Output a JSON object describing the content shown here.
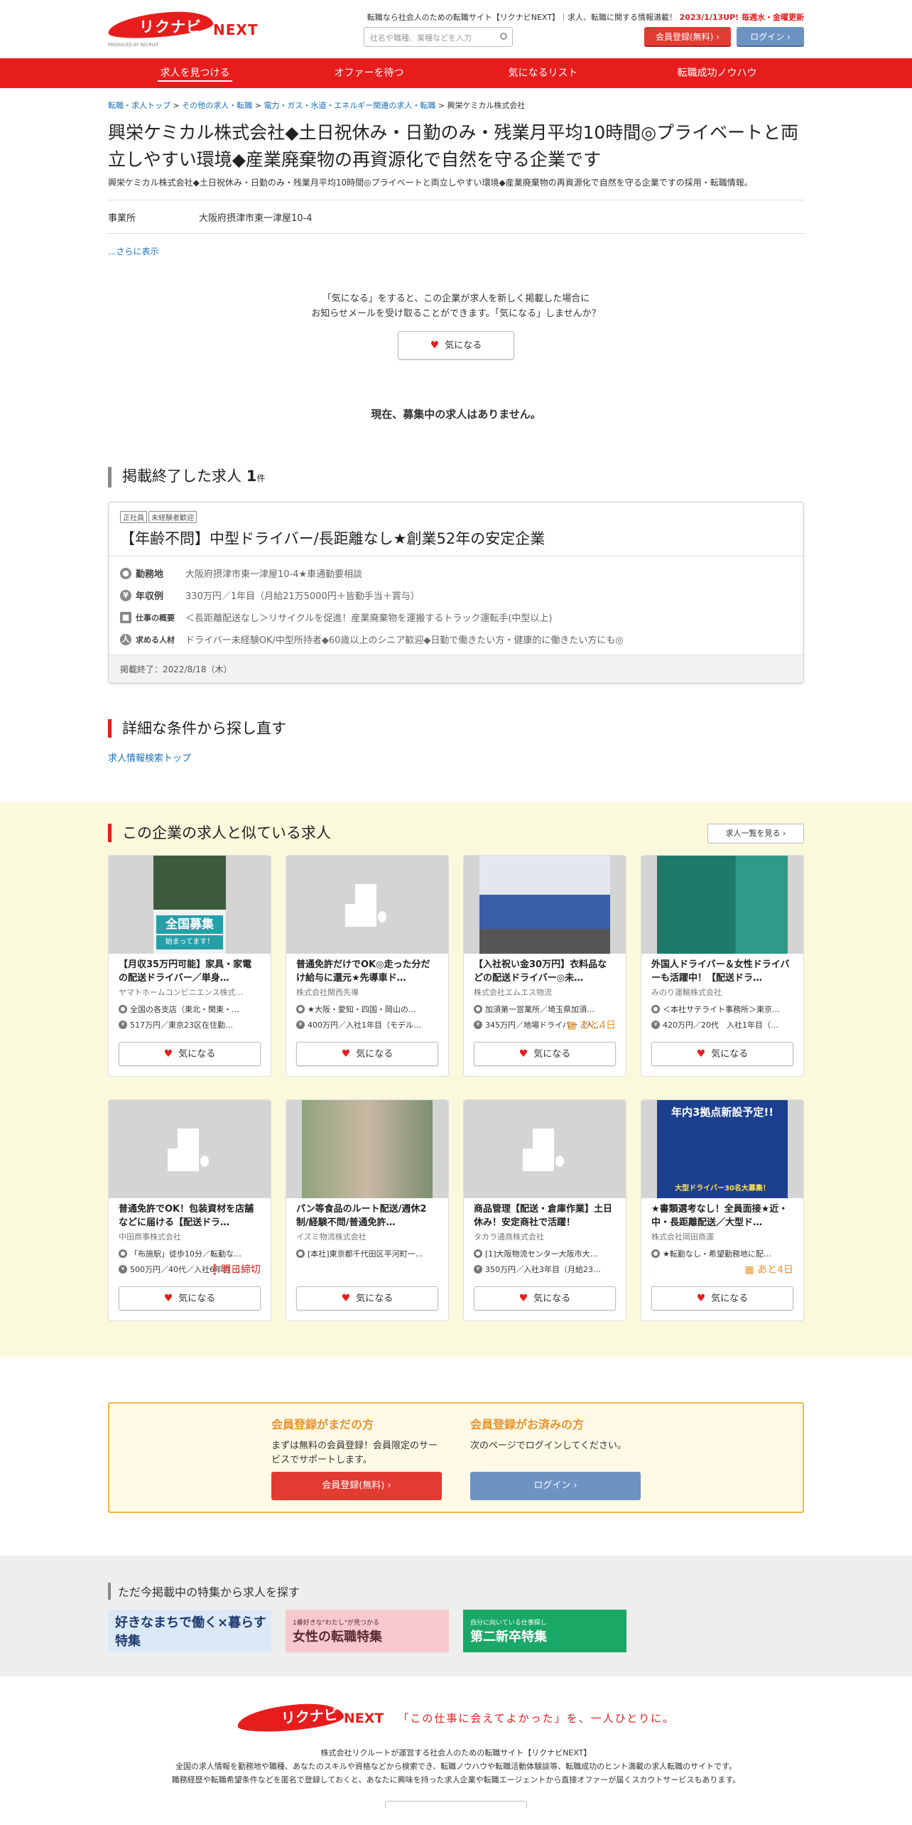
{
  "header": {
    "logo_text": "リクナビ",
    "logo_next": "NEXT",
    "logo_by": "PRODUCED BY RECRUIT",
    "tagline": "転職なら社会人のための転職サイト【リクナビNEXT】｜求人、転職に関する情報満載！",
    "update_note": "2023/1/13UP! 毎週水・金曜更新",
    "search_placeholder": "社名や職種、業種などを入力",
    "register_label": "会員登録(無料)",
    "login_label": "ログイン"
  },
  "nav": {
    "items": [
      "求人を見つける",
      "オファーを待つ",
      "気になるリスト",
      "転職成功ノウハウ"
    ]
  },
  "breadcrumb": {
    "items": [
      "転職・求人トップ",
      "その他の求人・転職",
      "電力・ガス・水道・エネルギー関連の求人・転職"
    ],
    "current": "興栄ケミカル株式会社",
    "sep": ">"
  },
  "company": {
    "title": "興栄ケミカル株式会社◆土日祝休み・日勤のみ・残業月平均10時間◎プライベートと両立しやすい環境◆産業廃棄物の再資源化で自然を守る企業です",
    "description": "興栄ケミカル株式会社◆土日祝休み・日勤のみ・残業月平均10時間◎プライベートと両立しやすい環境◆産業廃棄物の再資源化で自然を守る企業ですの採用・転職情報。",
    "office_label": "事業所",
    "office_value": "大阪府摂津市東一津屋10-4",
    "more_link": "...さらに表示"
  },
  "favorite": {
    "message_line1": "「気になる」をすると、この企業が求人を新しく掲載した場合に",
    "message_line2": "お知らせメールを受け取ることができます。「気になる」しませんか？",
    "button_label": "気になる"
  },
  "no_jobs_message": "現在、募集中の求人はありません。",
  "ended_section": {
    "heading": "掲載終了した求人",
    "count": "1",
    "count_unit": "件",
    "job": {
      "tags": [
        "正社員",
        "未経験者歓迎"
      ],
      "title": "【年齢不問】中型ドライバー/長距離なし★創業52年の安定企業",
      "rows": [
        {
          "label": "勤務地",
          "icon": "location-icon",
          "value": "大阪府摂津市東一津屋10-4★車通勤要相談"
        },
        {
          "label": "年収例",
          "icon": "yen-icon",
          "value": "330万円／1年目（月給21万5000円＋皆勤手当＋賞与）"
        },
        {
          "label": "仕事の概要",
          "icon": "briefcase-icon",
          "value": "＜長距離配送なし＞リサイクルを促進！産業廃棄物を運搬するトラック運転手(中型以上)"
        },
        {
          "label": "求める人材",
          "icon": "person-icon",
          "value": "ドライバー未経験OK/中型所持者◆60歳以上のシニア歓迎◆日勤で働きたい方・健康的に働きたい方にも◎"
        }
      ],
      "ended_date": "掲載終了：2022/8/18（木）"
    }
  },
  "search_again": {
    "heading": "詳細な条件から探し直す",
    "link": "求人情報検索トップ"
  },
  "similar": {
    "heading": "この企業の求人と似ている求人",
    "list_button": "求人一覧を見る",
    "fav_label": "気になる",
    "cards": [
      {
        "image": "photo-drivers",
        "img_text": "全国募集",
        "img_sub": "始まってます！",
        "title": "【月収35万円可能】家具・家電の配送ドライバー／単身…",
        "company": "ヤマトホームコンビニエンス株式…",
        "location": "全国の各支店（東北・関東・…",
        "salary": "517万円／東京23区在住勤…",
        "badge": ""
      },
      {
        "image": "building-placeholder",
        "img_text": "",
        "img_sub": "",
        "title": "普通免許だけでOK◎走った分だけ給与に還元★先導車ド…",
        "company": "株式会社関西先導",
        "location": "★大阪・愛知・四国・岡山の…",
        "salary": "400万円／入社1年目（モデル…",
        "badge": ""
      },
      {
        "image": "photo-trucks",
        "img_text": "",
        "img_sub": "",
        "title": "【入社祝い金30万円】衣料品などの配送ドライバー◎未…",
        "company": "株式会社エムエス物流",
        "location": "加須第一営業所／埼玉県加須…",
        "salary": "345万円／地場ドライバー（入…",
        "badge": "あと4日"
      },
      {
        "image": "photo-woman-truck",
        "img_text": "",
        "img_sub": "",
        "title": "外国人ドライバー＆女性ドライバーも活躍中！【配送ドラ…",
        "company": "みのり運輸株式会社",
        "location": "＜本社サテライト事務所＞東京…",
        "salary": "420万円／20代　入社1年目（…",
        "badge": ""
      },
      {
        "image": "building-placeholder",
        "img_text": "",
        "img_sub": "",
        "title": "普通免許でOK！包装資材を店舗などに届ける【配送ドラ…",
        "company": "中田商事株式会社",
        "location": "「布施駅」徒歩10分／転勤な…",
        "salary": "500万円／40代／入社6年目（…",
        "badge": "明日締切",
        "badge_red": true
      },
      {
        "image": "photo-two-women",
        "img_text": "",
        "img_sub": "",
        "title": "パン等食品のルート配送/週休2制/経験不問/普通免許…",
        "company": "イズミ物流株式会社",
        "location": "[本社]東京都千代田区平河町一…",
        "salary": "",
        "badge": ""
      },
      {
        "image": "building-placeholder",
        "img_text": "",
        "img_sub": "",
        "title": "商品管理【配送・倉庫作業】土日休み！安定商社で活躍！",
        "company": "タカラ通商株式会社",
        "location": "[1]大阪物流センター大阪市大…",
        "salary": "350万円／入社3年目（月給23…",
        "badge": ""
      },
      {
        "image": "photo-banner-blue",
        "img_text": "年内3拠点新設予定!!",
        "img_sub": "大型ドライバー30名大募集！",
        "title": "★書類選考なし！全員面接★近・中・長距離配送／大型ド…",
        "company": "株式会社岡田商運",
        "location": "★転勤なし・希望勤務地に配…",
        "salary": "",
        "badge": "あと4日"
      }
    ]
  },
  "register_box": {
    "left_heading": "会員登録がまだの方",
    "left_text": "まずは無料の会員登録！会員限定のサービスでサポートします。",
    "left_button": "会員登録(無料)",
    "right_heading": "会員登録がお済みの方",
    "right_text": "次のページでログインしてください。",
    "right_button": "ログイン"
  },
  "feature": {
    "heading": "ただ今掲載中の特集から求人を探す",
    "banners": [
      {
        "text": "好きなまちで働く×暮らす特集",
        "color": "#dbe9f7"
      },
      {
        "text": "女性の転職特集",
        "sub": "1番好きな\"わたし\"が見つかる",
        "color": "#f6c9cc"
      },
      {
        "text": "第二新卒特集",
        "sub": "自分に向いている仕事探し",
        "color": "#1aa866"
      }
    ]
  },
  "footer": {
    "catch": "「この仕事に会えてよかった」を、一人ひとりに。",
    "line1": "株式会社リクルートが運営する社会人のための転職サイト【リクナビNEXT】",
    "line2": "全国の求人情報を勤務地や職種、あなたのスキルや資格などから検索でき、転職ノウハウや転職活動体験談等、転職成功のヒント満載の求人転職のサイトです。",
    "line3": "職務経歴や転職希望条件などを匿名で登録しておくと、あなたに興味を持った求人企業や転職エージェントから直接オファーが届くスカウトサービスもあります。"
  },
  "colors": {
    "brand": "#e71d1d",
    "accent": "#e8932b",
    "link": "#1a6fb5"
  }
}
